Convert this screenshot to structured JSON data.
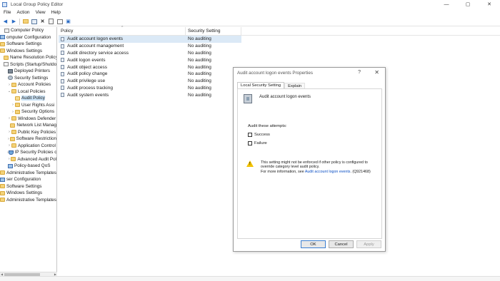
{
  "window": {
    "title": "Local Group Policy Editor",
    "controls": {
      "minimize": "—",
      "maximize": "▢",
      "close": "✕"
    }
  },
  "menu": [
    "File",
    "Action",
    "View",
    "Help"
  ],
  "tree": [
    {
      "label": "Computer Policy",
      "indent": 0,
      "icon": "doc",
      "arrow": ""
    },
    {
      "label": "omputer Configuration",
      "indent": 0,
      "icon": "pc",
      "arrow": ""
    },
    {
      "label": "Software Settings",
      "indent": 0,
      "icon": "folder",
      "arrow": ""
    },
    {
      "label": "Windows Settings",
      "indent": 0,
      "icon": "folder",
      "arrow": ""
    },
    {
      "label": "Name Resolution Policy",
      "indent": 1,
      "icon": "folder",
      "arrow": ""
    },
    {
      "label": "Scripts (Startup/Shutdo",
      "indent": 1,
      "icon": "doc",
      "arrow": ""
    },
    {
      "label": "Deployed Printers",
      "indent": 1,
      "icon": "printer",
      "arrow": ""
    },
    {
      "label": "Security Settings",
      "indent": 1,
      "icon": "gear",
      "arrow": ""
    },
    {
      "label": "Account Policies",
      "indent": 2,
      "icon": "folder",
      "arrow": ">"
    },
    {
      "label": "Local Policies",
      "indent": 2,
      "icon": "folder",
      "arrow": "v"
    },
    {
      "label": "Audit Policy",
      "indent": 3,
      "icon": "folder open",
      "arrow": "",
      "selected": true
    },
    {
      "label": "User Rights Assi",
      "indent": 3,
      "icon": "folder",
      "arrow": ">"
    },
    {
      "label": "Security Options",
      "indent": 3,
      "icon": "folder",
      "arrow": ">"
    },
    {
      "label": "Windows Defender",
      "indent": 2,
      "icon": "folder",
      "arrow": ">"
    },
    {
      "label": "Network List Manag",
      "indent": 2,
      "icon": "folder",
      "arrow": ""
    },
    {
      "label": "Public Key Policies",
      "indent": 2,
      "icon": "folder",
      "arrow": ">"
    },
    {
      "label": "Software Restriction",
      "indent": 2,
      "icon": "folder",
      "arrow": ">"
    },
    {
      "label": "Application Control",
      "indent": 2,
      "icon": "folder",
      "arrow": ">"
    },
    {
      "label": "IP Security Policies c",
      "indent": 2,
      "icon": "shield",
      "arrow": ">"
    },
    {
      "label": "Advanced Audit Pol",
      "indent": 2,
      "icon": "folder",
      "arrow": ">"
    },
    {
      "label": "Policy-based QoS",
      "indent": 1,
      "icon": "pc",
      "arrow": ""
    },
    {
      "label": "Administrative Templates",
      "indent": 0,
      "icon": "folder",
      "arrow": ""
    },
    {
      "label": "ser Configuration",
      "indent": 0,
      "icon": "pc",
      "arrow": ""
    },
    {
      "label": "Software Settings",
      "indent": 0,
      "icon": "folder",
      "arrow": ""
    },
    {
      "label": "Windows Settings",
      "indent": 0,
      "icon": "folder",
      "arrow": ""
    },
    {
      "label": "Administrative Templates",
      "indent": 0,
      "icon": "folder",
      "arrow": ""
    }
  ],
  "list": {
    "headers": {
      "policy": "Policy",
      "setting": "Security Setting"
    },
    "rows": [
      {
        "policy": "Audit account logon events",
        "setting": "No auditing",
        "selected": true
      },
      {
        "policy": "Audit account management",
        "setting": "No auditing"
      },
      {
        "policy": "Audit directory service access",
        "setting": "No auditing"
      },
      {
        "policy": "Audit logon events",
        "setting": "No auditing"
      },
      {
        "policy": "Audit object access",
        "setting": "No auditing"
      },
      {
        "policy": "Audit policy change",
        "setting": "No auditing"
      },
      {
        "policy": "Audit privilege use",
        "setting": "No auditing"
      },
      {
        "policy": "Audit process tracking",
        "setting": "No auditing"
      },
      {
        "policy": "Audit system events",
        "setting": "No auditing"
      }
    ]
  },
  "dialog": {
    "title": "Audit account logon events Properties",
    "help": "?",
    "close": "✕",
    "tabs": {
      "active": "Local Security Setting",
      "inactive": "Explain"
    },
    "policy_name": "Audit account logon events",
    "audit_label": "Audit these attempts:",
    "success_label": "Success",
    "failure_label": "Failure",
    "warning_text_1": "This setting might not be enforced if other policy is configured to override category level audit policy.",
    "warning_text_2": "For more information, see ",
    "warning_link": "Audit account logon events",
    "warning_suffix": ". (Q921468)",
    "buttons": {
      "ok": "OK",
      "cancel": "Cancel",
      "apply": "Apply"
    }
  }
}
